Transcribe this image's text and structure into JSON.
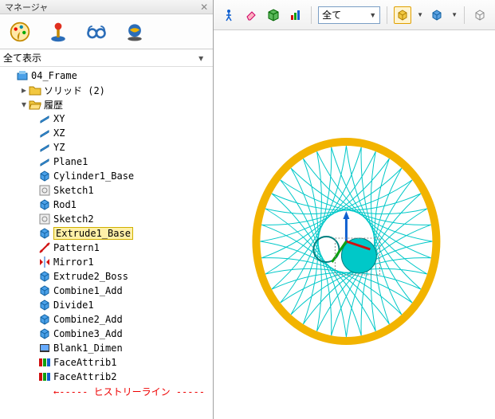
{
  "panel": {
    "title": "マネージャ",
    "close_glyph": "✕"
  },
  "filter": {
    "label": "全て表示"
  },
  "tree": {
    "root": "04_Frame",
    "solid_folder": "ソリッド (2)",
    "history_folder": "履歴",
    "items": [
      {
        "label": "XY",
        "icon": "plane"
      },
      {
        "label": "XZ",
        "icon": "plane"
      },
      {
        "label": "YZ",
        "icon": "plane"
      },
      {
        "label": "Plane1",
        "icon": "plane"
      },
      {
        "label": "Cylinder1_Base",
        "icon": "feature"
      },
      {
        "label": "Sketch1",
        "icon": "sketch"
      },
      {
        "label": "Rod1",
        "icon": "feature"
      },
      {
        "label": "Sketch2",
        "icon": "sketch"
      },
      {
        "label": "Extrude1_Base",
        "icon": "feature",
        "selected": true
      },
      {
        "label": "Pattern1",
        "icon": "pattern"
      },
      {
        "label": "Mirror1",
        "icon": "mirror"
      },
      {
        "label": "Extrude2_Boss",
        "icon": "feature"
      },
      {
        "label": "Combine1_Add",
        "icon": "feature"
      },
      {
        "label": "Divide1",
        "icon": "feature"
      },
      {
        "label": "Combine2_Add",
        "icon": "feature"
      },
      {
        "label": "Combine3_Add",
        "icon": "feature"
      },
      {
        "label": "Blank1_Dimen",
        "icon": "blank"
      },
      {
        "label": "FaceAttrib1",
        "icon": "rgb"
      },
      {
        "label": "FaceAttrib2",
        "icon": "rgb"
      }
    ],
    "history_line": "←----- ヒストリーライン -----"
  },
  "view_toolbar": {
    "filter_value": "全て"
  },
  "colors": {
    "gold": "#f2b400",
    "cyan": "#00c8c8",
    "blue": "#1060d0",
    "red": "#d01010",
    "green": "#10a010"
  }
}
